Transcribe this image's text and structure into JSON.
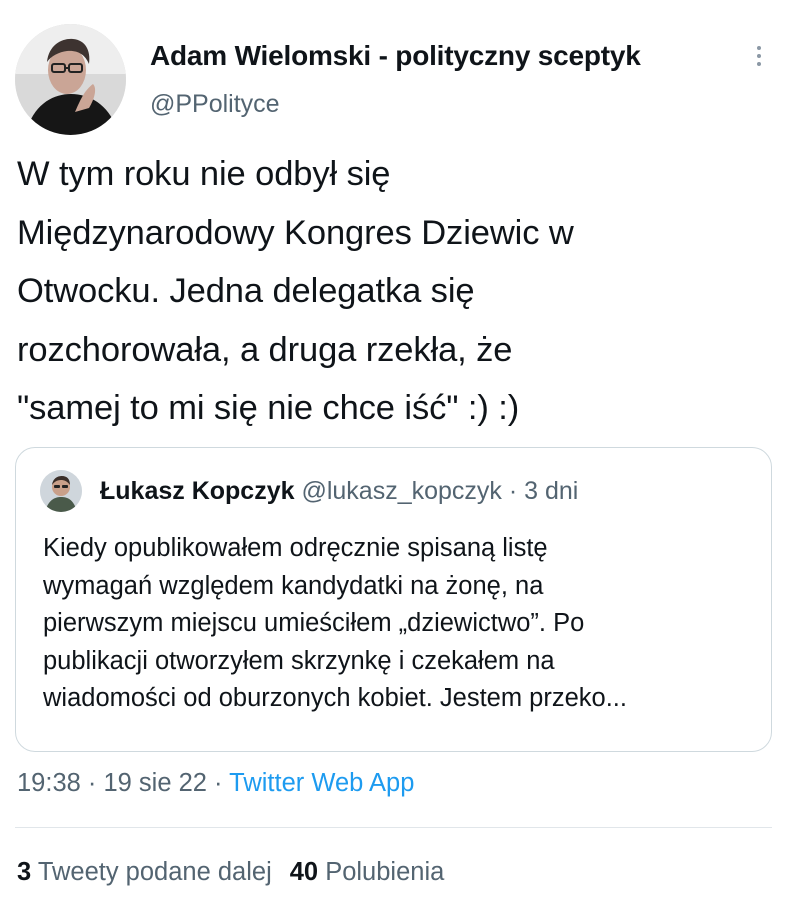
{
  "tweet": {
    "author": {
      "name": "Adam Wielomski - polityczny sceptyk",
      "handle": "@PPolityce"
    },
    "text": "W tym roku nie odbył się\nMiędzynarodowy Kongres Dziewic w\nOtwocku. Jedna delegatka się\nrozchorowała, a druga rzekła, że\n\"samej to mi się nie chce iść\" :) :)",
    "timestamp": "19:38 · 19 sie 22",
    "separator": " · ",
    "source": "Twitter Web App"
  },
  "quoted": {
    "name": "Łukasz Kopczyk",
    "handle": "@lukasz_kopczyk · 3 dni",
    "text": "Kiedy opublikowałem odręcznie spisaną listę\nwymagań względem kandydatki na żonę, na\npierwszym miejscu umieściłem „dziewictwo”. Po\npublikacji otworzyłem skrzynkę i czekałem na\nwiadomości od oburzonych kobiet. Jestem przeko..."
  },
  "stats": {
    "retweets_count": "3",
    "retweets_label": "Tweety podane dalej",
    "likes_count": "40",
    "likes_label": "Polubienia"
  }
}
